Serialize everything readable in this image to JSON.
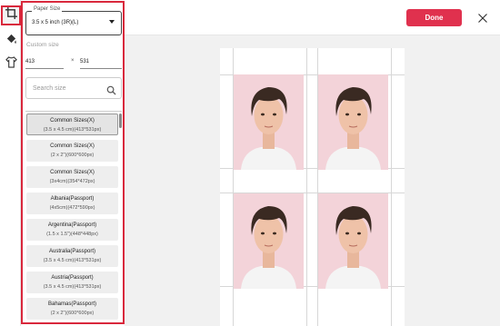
{
  "toolbar": {
    "tools": [
      {
        "icon": "crop-icon",
        "active": true
      },
      {
        "icon": "fill-bucket-icon",
        "active": false
      },
      {
        "icon": "shirt-icon",
        "active": false
      }
    ]
  },
  "panel": {
    "paper_size_label": "Paper Size",
    "paper_size_value": "3.5 x 5 inch (3R)(L)",
    "custom_size_label": "Custom size",
    "width_value": "413",
    "height_value": "531",
    "times_symbol": "×",
    "search_placeholder": "Search size",
    "sizes": [
      {
        "name": "Common Sizes(X)",
        "desc": "(3.5 x 4.5 cm)(413*531px)",
        "selected": true
      },
      {
        "name": "Common Sizes(X)",
        "desc": "(2 x 2\")(600*600px)"
      },
      {
        "name": "Common Sizes(X)",
        "desc": "(3x4cm)(354*472px)"
      },
      {
        "name": "Albania(Passport)",
        "desc": "(4x5cm)(472*590px)"
      },
      {
        "name": "Argentina(Passport)",
        "desc": "(1.5 x 1.5\")(448*448px)"
      },
      {
        "name": "Australia(Passport)",
        "desc": "(3.5 x 4.5 cm)(413*531px)"
      },
      {
        "name": "Austria(Passport)",
        "desc": "(3.5 x 4.5 cm)(413*531px)"
      },
      {
        "name": "Bahamas(Passport)",
        "desc": "(2 x 2\")(600*600px)"
      }
    ]
  },
  "header": {
    "done_label": "Done",
    "accent_color": "#e0314e"
  },
  "canvas": {
    "photo_count": 4,
    "photo_background": "#f3d3d9"
  }
}
